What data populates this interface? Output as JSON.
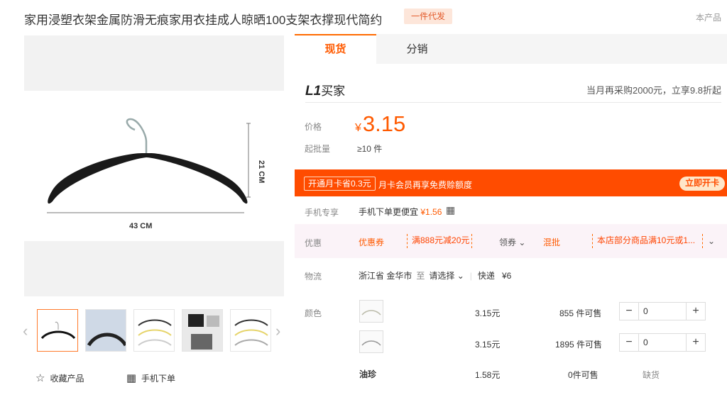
{
  "header": {
    "title": "家用浸塑衣架金属防滑无痕家用衣挂成人晾晒100支架衣撑现代简约",
    "badge": "一件代发",
    "top_right": "本产品"
  },
  "gallery": {
    "dim_height": "21 CM",
    "dim_width": "43 CM",
    "actions": {
      "favorite": "收藏产品",
      "mobile_order": "手机下单"
    }
  },
  "tabs": [
    {
      "label": "现货"
    },
    {
      "label": "分销"
    }
  ],
  "buyer": {
    "level_prefix": "L1",
    "level_label": "买家",
    "promo": "当月再采购2000元，立享9.8折起"
  },
  "pricing": {
    "price_label": "价格",
    "currency": "¥",
    "price": "3.15",
    "moq_label": "起批量",
    "moq_value": "≥10 件"
  },
  "membership": {
    "badge": "开通月卡省0.3元",
    "text": "月卡会员再享免费赊额度",
    "button": "立即开卡",
    "colors": {
      "banner": "#ff4c00"
    }
  },
  "mobile": {
    "label": "手机专享",
    "text": "手机下单更便宜",
    "price": "¥1.56"
  },
  "discounts": {
    "label": "优惠",
    "coupon_label": "优惠券",
    "coupon": "满888元减20元",
    "claim": "领券",
    "mixed_label": "混批",
    "mixed_text": "本店部分商品满10元或1..."
  },
  "logistics": {
    "label": "物流",
    "from": "浙江省 金华市",
    "to_label": "至",
    "to_select": "请选择",
    "shipping_label": "快递",
    "shipping_fee": "¥6"
  },
  "sku": {
    "label": "颜色",
    "rows": [
      {
        "name": "",
        "price": "3.15元",
        "stock": "855 件可售",
        "qty": "0"
      },
      {
        "name": "",
        "price": "3.15元",
        "stock": "1895 件可售",
        "qty": "0"
      },
      {
        "name": "油珍",
        "price": "1.58元",
        "stock": "0件可售",
        "status": "缺货"
      }
    ]
  }
}
